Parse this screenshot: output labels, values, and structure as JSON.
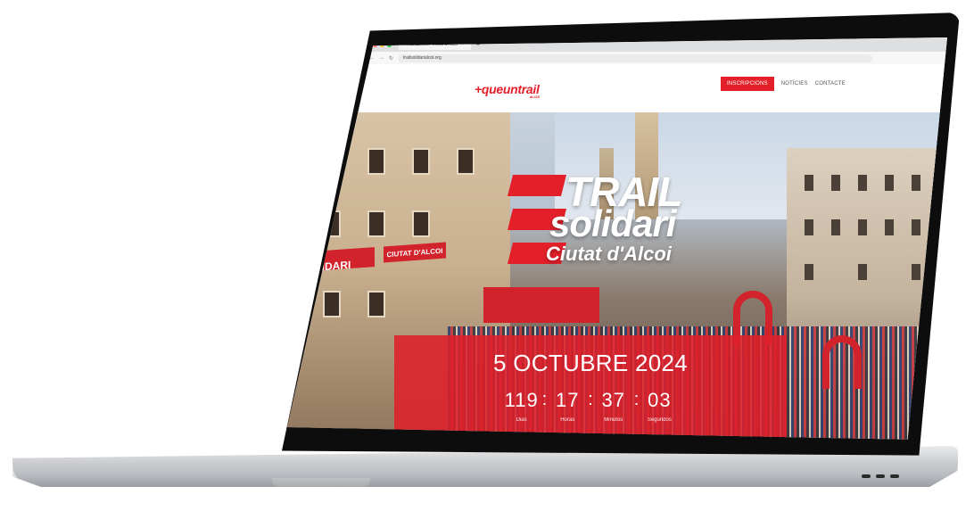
{
  "browser": {
    "tab_title": "Trail Solidari Ciutat d'Alcoi",
    "tab_close": "×",
    "new_tab": "+",
    "url": "trailsolidarialcoi.org",
    "nav_back": "←",
    "nav_forward": "→",
    "nav_reload": "↻"
  },
  "header": {
    "logo": "+queuntrail",
    "logo_sub": "ALCOI",
    "nav": {
      "inscripcions": "INSCRIPCIONS",
      "noticies": "NOTÍCIES",
      "contacte": "CONTACTE"
    }
  },
  "hero": {
    "banner_left": "RAIL SOLIDARI",
    "banner_left2": "CIUTAT D'ALCOI",
    "logo_line1": "TRAIL",
    "logo_line2": "solidari",
    "logo_line3": "Ciutat d'Alcoi",
    "date": "5 OCTUBRE 2024",
    "countdown": {
      "days": "119",
      "hours": "17",
      "minutes": "37",
      "seconds": "03",
      "sep": ":",
      "days_label": "Dias",
      "hours_label": "Horas",
      "minutes_label": "Minutos",
      "seconds_label": "Segundos"
    }
  },
  "colors": {
    "brand_red": "#e3202a",
    "laptop_bezel": "#0d0d0e",
    "laptop_body": "#cfd1d4"
  }
}
